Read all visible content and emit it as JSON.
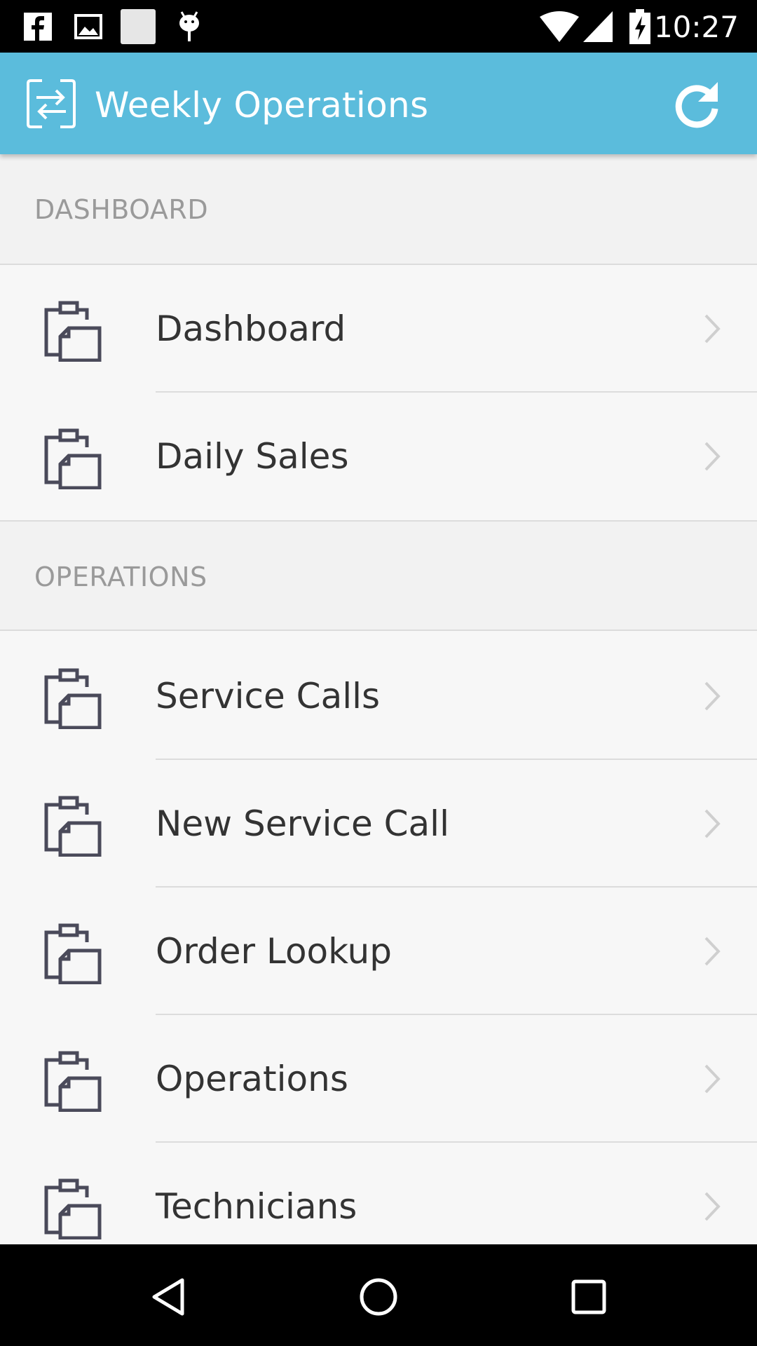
{
  "status_bar": {
    "time": "10:27",
    "icons": [
      "facebook-icon",
      "image-icon",
      "blank-notification-icon",
      "android-debug-icon",
      "wifi-icon",
      "cell-signal-icon",
      "battery-charging-icon"
    ]
  },
  "app_bar": {
    "title": "Weekly Operations",
    "logo_icon": "swap-arrows-icon",
    "action_icon": "refresh-icon",
    "color": "#5bbcdc"
  },
  "sections": [
    {
      "header": "DASHBOARD",
      "items": [
        {
          "label": "Dashboard",
          "icon": "clipboard-icon"
        },
        {
          "label": "Daily Sales",
          "icon": "clipboard-icon"
        }
      ]
    },
    {
      "header": "OPERATIONS",
      "items": [
        {
          "label": "Service Calls",
          "icon": "clipboard-icon"
        },
        {
          "label": "New Service Call",
          "icon": "clipboard-icon"
        },
        {
          "label": "Order Lookup",
          "icon": "clipboard-icon"
        },
        {
          "label": "Operations",
          "icon": "clipboard-icon"
        },
        {
          "label": "Technicians",
          "icon": "clipboard-icon"
        }
      ]
    }
  ],
  "nav_bar": {
    "buttons": [
      "back-icon",
      "home-icon",
      "recents-icon"
    ]
  }
}
